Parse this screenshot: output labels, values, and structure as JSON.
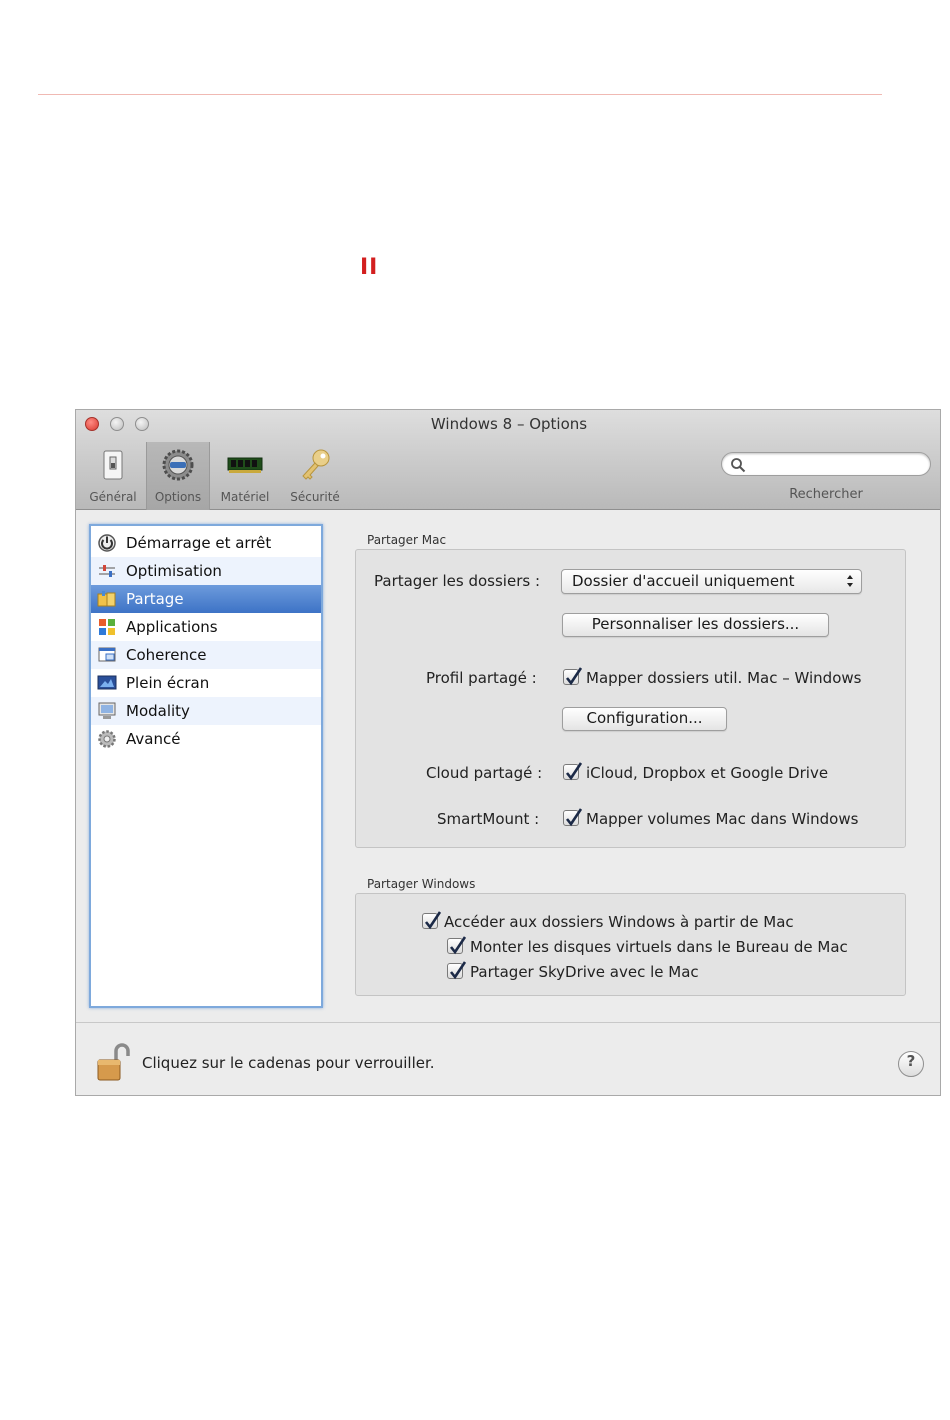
{
  "page": {
    "pause_symbol": "II"
  },
  "window": {
    "title": "Windows 8 – Options",
    "toolbar": [
      {
        "label": "Général",
        "icon": "switch-icon"
      },
      {
        "label": "Options",
        "icon": "gear-icon"
      },
      {
        "label": "Matériel",
        "icon": "memory-chip-icon"
      },
      {
        "label": "Sécurité",
        "icon": "key-icon"
      }
    ],
    "toolbar_selected": "Options",
    "search": {
      "label": "Rechercher",
      "value": ""
    }
  },
  "sidebar": {
    "items": [
      {
        "label": "Démarrage et arrêt",
        "icon": "power-icon"
      },
      {
        "label": "Optimisation",
        "icon": "sliders-icon"
      },
      {
        "label": "Partage",
        "icon": "shared-folder-icon"
      },
      {
        "label": "Applications",
        "icon": "applications-icon"
      },
      {
        "label": "Coherence",
        "icon": "coherence-icon"
      },
      {
        "label": "Plein écran",
        "icon": "fullscreen-icon"
      },
      {
        "label": "Modality",
        "icon": "modality-icon"
      },
      {
        "label": "Avancé",
        "icon": "advanced-gear-icon"
      }
    ],
    "selected": "Partage"
  },
  "share_mac": {
    "title": "Partager Mac",
    "share_folders_label": "Partager les dossiers :",
    "share_folders_value": "Dossier d'accueil uniquement",
    "customize_button": "Personnaliser les dossiers...",
    "shared_profile_label": "Profil partagé :",
    "shared_profile_checkbox": "Mapper dossiers util. Mac – Windows",
    "configuration_button": "Configuration...",
    "shared_cloud_label": "Cloud partagé :",
    "shared_cloud_checkbox": "iCloud, Dropbox et Google Drive",
    "smartmount_label": "SmartMount :",
    "smartmount_checkbox": "Mapper volumes Mac dans Windows"
  },
  "share_windows": {
    "title": "Partager Windows",
    "access_checkbox": "Accéder aux dossiers Windows à partir de Mac",
    "mount_checkbox": "Monter les disques virtuels dans le Bureau de Mac",
    "skydrive_checkbox": "Partager SkyDrive avec le Mac"
  },
  "footer": {
    "lock_text": "Cliquez sur le cadenas pour verrouiller.",
    "help_symbol": "?"
  }
}
